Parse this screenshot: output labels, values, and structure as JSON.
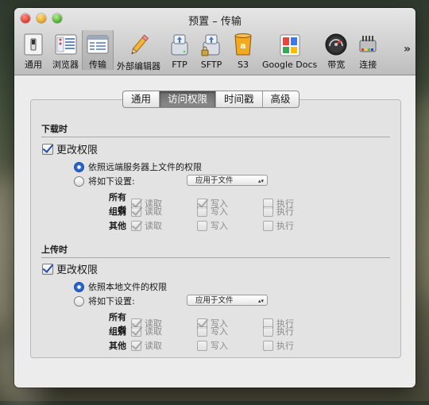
{
  "window": {
    "title": "预置 – 传输"
  },
  "toolbar": {
    "items": [
      {
        "label": "通用",
        "icon": "general-switch-icon"
      },
      {
        "label": "浏览器",
        "icon": "browser-list-icon"
      },
      {
        "label": "传输",
        "icon": "transfer-icon",
        "selected": true
      },
      {
        "label": "外部编辑器",
        "icon": "pencil-icon"
      },
      {
        "label": "FTP",
        "icon": "ftp-drive-icon"
      },
      {
        "label": "SFTP",
        "icon": "sftp-drive-icon"
      },
      {
        "label": "S3",
        "icon": "s3-bucket-icon"
      },
      {
        "label": "Google Docs",
        "icon": "google-docs-icon"
      },
      {
        "label": "带宽",
        "icon": "bandwidth-gauge-icon"
      },
      {
        "label": "连接",
        "icon": "connection-icon"
      }
    ],
    "overflow": "»"
  },
  "tabs": [
    "通用",
    "访问权限",
    "时间戳",
    "高级"
  ],
  "active_tab": "访问权限",
  "download": {
    "heading": "下载时",
    "change_perms": "更改权限",
    "option_remote": "依照远端服务器上文件的权限",
    "option_set": "将如下设置:",
    "apply_popup": "应用于文件",
    "owner": "所有者",
    "group": "组别",
    "other": "其他",
    "read": "读取",
    "write": "写入",
    "exec": "执行"
  },
  "upload": {
    "heading": "上传时",
    "change_perms": "更改权限",
    "option_local": "依照本地文件的权限",
    "option_set": "将如下设置:",
    "apply_popup": "应用于文件",
    "owner": "所有者",
    "group": "组别",
    "other": "其他",
    "read": "读取",
    "write": "写入",
    "exec": "执行"
  }
}
